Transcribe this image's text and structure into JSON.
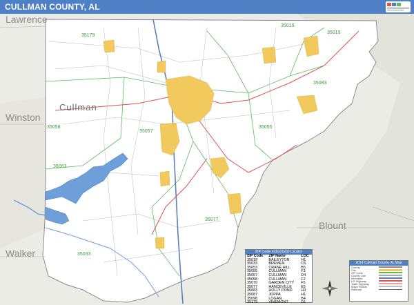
{
  "title": "CULLMAN COUNTY, AL",
  "logo_icon": "publisher-logo-icon",
  "colors": {
    "title_bar": "#4f7fc4",
    "city_fill": "#f2c95c",
    "water": "#6f9fd8",
    "surrounding_relief": "#e8e8e0",
    "zip_label": "#3e9a3e",
    "county_label": "#8a8a8a",
    "highway": "#d9534f"
  },
  "county_labels": [
    "Lawrence",
    "Winston",
    "Walker",
    "Blount"
  ],
  "city_label": "Cullman",
  "zip_labels": [
    "35019",
    "35057",
    "35179",
    "35083",
    "35058",
    "35055",
    "35063",
    "35087",
    "35077",
    "35033"
  ],
  "zip_index": {
    "title": "ZIP Code Index/Grid Locator",
    "headers": [
      "ZIP Code",
      "ZIP Name",
      "LOC"
    ],
    "rows": [
      [
        "35019",
        "BAILEYTON",
        "H1"
      ],
      [
        "35033",
        "BREMEN",
        "C6"
      ],
      [
        "35053",
        "CRANE HILL",
        "B5"
      ],
      [
        "35055",
        "CULLMAN",
        "F3"
      ],
      [
        "35057",
        "CULLMAN",
        "D4"
      ],
      [
        "35058",
        "CULLMAN",
        "F2"
      ],
      [
        "35070",
        "GARDEN CITY",
        "F5"
      ],
      [
        "35077",
        "HANCEVILLE",
        "E5"
      ],
      [
        "35083",
        "HOLLY POND",
        "H3"
      ],
      [
        "35087",
        "JOPPA",
        "H1"
      ],
      [
        "35098",
        "LOGAN",
        "B4"
      ],
      [
        "35179",
        "VINEMONT",
        "D1"
      ]
    ]
  },
  "legend": {
    "title": "2014 Cullman County, AL Map",
    "rows": [
      "County",
      "City",
      "ZIP Code",
      "County Line",
      "Interstate",
      "US Highway",
      "State Highway",
      "Major Roads",
      "Railroad"
    ]
  },
  "compass_icon": "north-arrow-compass-icon"
}
